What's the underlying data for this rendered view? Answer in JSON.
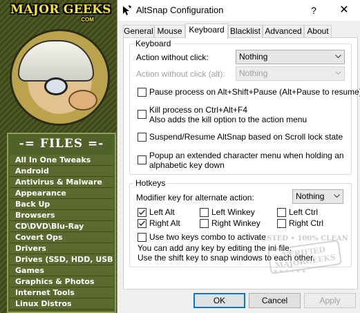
{
  "site": {
    "logo_text": "MAJOR GEEKS",
    "logo_sub": ".COM",
    "files_header": "-= FILES =-",
    "categories": [
      "All In One Tweaks",
      "Android",
      "Antivirus & Malware",
      "Appearance",
      "Back Up",
      "Browsers",
      "CD\\DVD\\Blu-Ray",
      "Covert Ops",
      "Drivers",
      "Drives (SSD, HDD, USB)",
      "Games",
      "Graphics & Photos",
      "Internet Tools",
      "Linux Distros"
    ]
  },
  "window": {
    "title": "AltSnap Configuration",
    "help_label": "?",
    "close_label": "✕"
  },
  "tabs": [
    {
      "label": "General",
      "active": false
    },
    {
      "label": "Mouse",
      "active": false
    },
    {
      "label": "Keyboard",
      "active": true
    },
    {
      "label": "Blacklist",
      "active": false
    },
    {
      "label": "Advanced",
      "active": false
    },
    {
      "label": "About",
      "active": false
    }
  ],
  "keyboard_group": {
    "title": "Keyboard",
    "action_without_click_label": "Action without click:",
    "action_without_click_value": "Nothing",
    "action_without_click_alt_label": "Action without click (alt):",
    "action_without_click_alt_value": "Nothing",
    "pause_process": "Pause process on Alt+Shift+Pause (Alt+Pause to resume)",
    "kill_process_line1": "Kill process on Ctrl+Alt+F4",
    "kill_process_line2": "Also adds the kill option to the action menu",
    "suspend_resume": "Suspend/Resume AltSnap based on Scroll lock state",
    "popup_line1": "Popup an extended character menu when holding an",
    "popup_line2": "alphabetic key down"
  },
  "hotkeys_group": {
    "title": "Hotkeys",
    "modifier_label": "Modifier key for alternate action:",
    "modifier_value": "Nothing",
    "left_alt": "Left Alt",
    "left_winkey": "Left Winkey",
    "left_ctrl": "Left Ctrl",
    "right_alt": "Right Alt",
    "right_winkey": "Right Winkey",
    "right_ctrl": "Right Ctrl",
    "two_keys": "Use two keys combo to activate",
    "info_line1": "You can add any key by editing the ini file.",
    "info_line2": "Use the shift key to snap windows to each other."
  },
  "buttons": {
    "ok": "OK",
    "cancel": "Cancel",
    "apply": "Apply"
  },
  "watermark": {
    "line1": "TESTED • 100% CLEAN",
    "stamp": "VERIFIED MAJORGEEKS",
    "line3": "★★★★★★"
  }
}
